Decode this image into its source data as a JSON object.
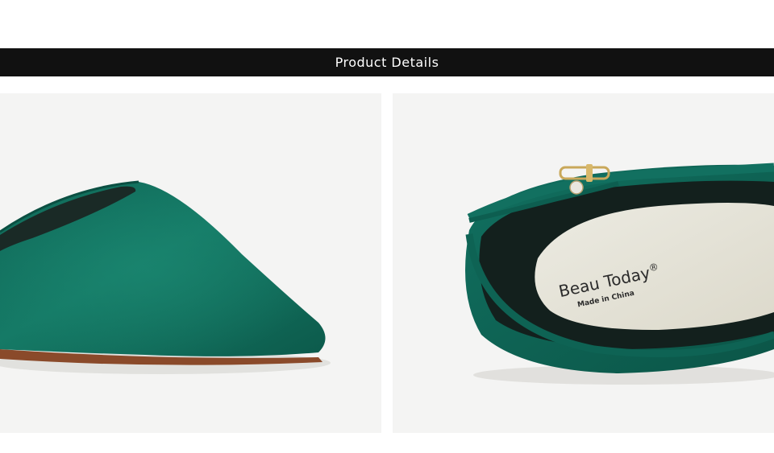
{
  "section_header": {
    "title": "Product Details"
  },
  "images": [
    {
      "subject": "green suede pointed toe"
    },
    {
      "subject": "green suede shoe with insole and buckle strap",
      "insole_brand": "Beau Today",
      "insole_mark": "®",
      "insole_origin": "Made in China"
    }
  ],
  "colors": {
    "banner": "#111111",
    "suede": "#13705e",
    "insole": "#e6e4d9"
  }
}
